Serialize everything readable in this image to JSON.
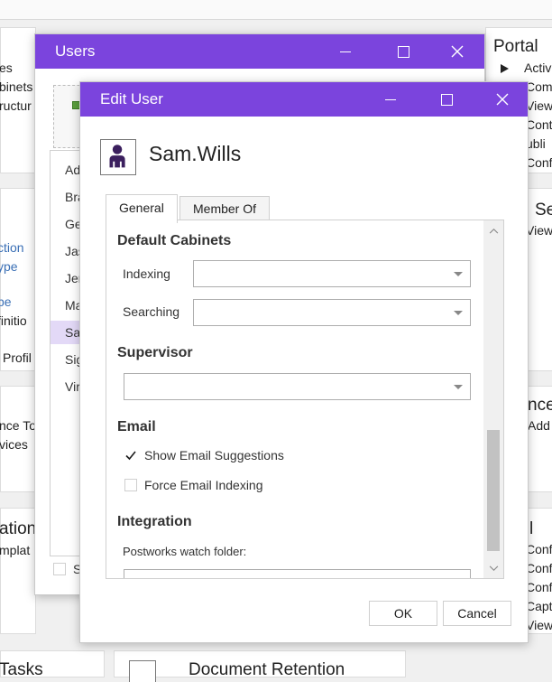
{
  "background": {
    "left_items": {
      "l1": "es",
      "l2": "binets",
      "l3": "ructur",
      "l4": "ction",
      "l5": "ype",
      "l6": "pe",
      "l7": "finitio",
      "l8": "Profil",
      "l9": "nce To",
      "l10": "vices",
      "l11": "ation",
      "l12": "mplat",
      "l13": "Tasks"
    },
    "right_items": {
      "portal": "Portal",
      "r1": "Activ",
      "r2": "Com",
      "r3": "View",
      "r4": "Cont",
      "r5": "ubli",
      "r6": "Conf",
      "r7": "Se",
      "r8": "View",
      "r9": "nce",
      "r10": "Add",
      "r11": "l",
      "r12": "Conf",
      "r13": "Conf",
      "r14": "Conf",
      "r15": "Capt",
      "r16": "View"
    },
    "bottom": {
      "doc_retention": "Document Retention"
    }
  },
  "users_window": {
    "title": "Users",
    "list": [
      "Ad",
      "Bra",
      "Ge",
      "Jas",
      "Jer",
      "Ma",
      "Sa",
      "Sig",
      "Vir"
    ],
    "selected_index": 6,
    "footer_checkbox_label": "S"
  },
  "edit_user": {
    "title": "Edit User",
    "username": "Sam.Wills",
    "tabs": [
      "General",
      "Member Of"
    ],
    "active_tab": "General",
    "default_cabinets": {
      "title": "Default Cabinets",
      "indexing_label": "Indexing",
      "indexing_value": "",
      "searching_label": "Searching",
      "searching_value": ""
    },
    "supervisor": {
      "title": "Supervisor",
      "value": ""
    },
    "email": {
      "title": "Email",
      "show_suggestions_label": "Show Email Suggestions",
      "show_suggestions_checked": true,
      "force_indexing_label": "Force Email Indexing",
      "force_indexing_checked": false
    },
    "integration": {
      "title": "Integration",
      "postworks_label": "Postworks watch folder:"
    },
    "ok_label": "OK",
    "cancel_label": "Cancel"
  },
  "colors": {
    "titlebar": "#7b44dd",
    "selected_row": "#e3d9f7",
    "check": "#1a1a1a",
    "accent_link": "#3a6fb5"
  }
}
